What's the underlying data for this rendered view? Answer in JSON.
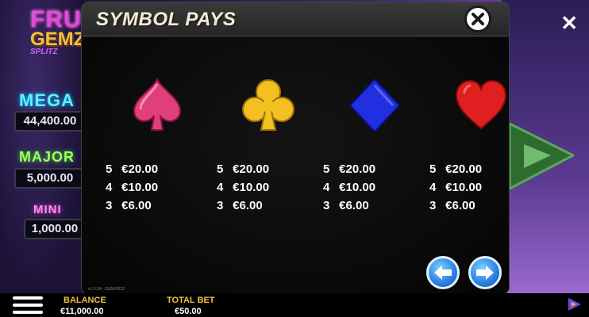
{
  "logo": {
    "line1": "FRUIT",
    "line2": "GEMZ",
    "line3": "SPLITZ"
  },
  "jackpots": [
    {
      "label": "MEGA",
      "value": "44,400.00"
    },
    {
      "label": "MAJOR",
      "value": "5,000.00"
    },
    {
      "label": "MINI",
      "value": "1,000.00"
    }
  ],
  "modal": {
    "title": "SYMBOL PAYS",
    "version": "v1.0.24 - 01/05/2022",
    "symbols": [
      {
        "icon": "spade-icon",
        "color": "#e0407a",
        "pays": [
          {
            "count": "5",
            "amount": "€20.00"
          },
          {
            "count": "4",
            "amount": "€10.00"
          },
          {
            "count": "3",
            "amount": "€6.00"
          }
        ]
      },
      {
        "icon": "club-icon",
        "color": "#f2c020",
        "pays": [
          {
            "count": "5",
            "amount": "€20.00"
          },
          {
            "count": "4",
            "amount": "€10.00"
          },
          {
            "count": "3",
            "amount": "€6.00"
          }
        ]
      },
      {
        "icon": "diamond-icon",
        "color": "#2030e0",
        "pays": [
          {
            "count": "5",
            "amount": "€20.00"
          },
          {
            "count": "4",
            "amount": "€10.00"
          },
          {
            "count": "3",
            "amount": "€6.00"
          }
        ]
      },
      {
        "icon": "heart-icon",
        "color": "#e02020",
        "pays": [
          {
            "count": "5",
            "amount": "€20.00"
          },
          {
            "count": "4",
            "amount": "€10.00"
          },
          {
            "count": "3",
            "amount": "€6.00"
          }
        ]
      }
    ]
  },
  "bottom_bar": {
    "balance_label": "BALANCE",
    "balance_value": "€11,000.00",
    "total_bet_label": "TOTAL BET",
    "total_bet_value": "€50.00"
  }
}
